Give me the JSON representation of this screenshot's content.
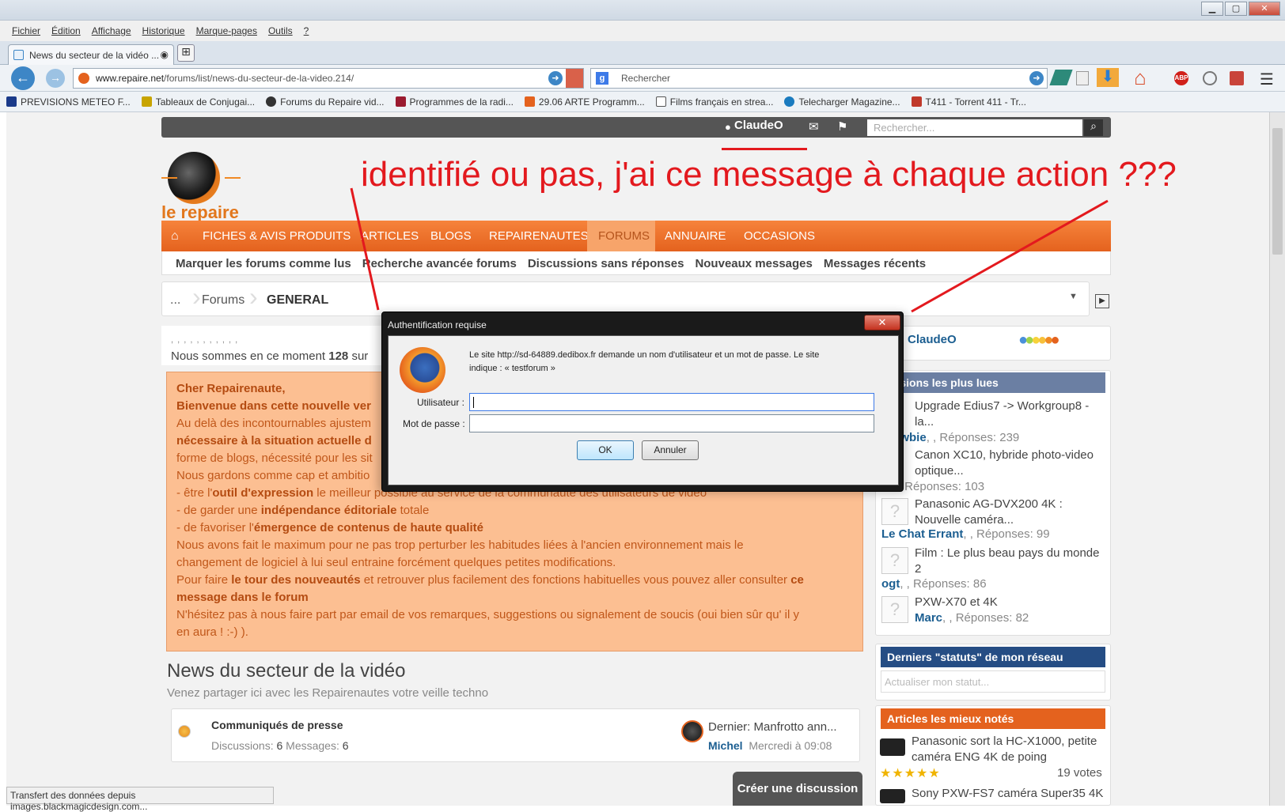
{
  "browser": {
    "menu": [
      "Fichier",
      "Édition",
      "Affichage",
      "Historique",
      "Marque-pages",
      "Outils",
      "?"
    ],
    "tab_title": "News du secteur de la vidéo ...",
    "url_domain": "www.repaire.net",
    "url_path": "/forums/list/news-du-secteur-de-la-video.214/",
    "search_placeholder": "Rechercher",
    "bookmarks": [
      {
        "label": "PREVISIONS METEO F...",
        "color": "#1a3a8a"
      },
      {
        "label": "Tableaux de Conjugai...",
        "color": "#c8a400"
      },
      {
        "label": "Forums du Repaire vid...",
        "color": "#333"
      },
      {
        "label": "Programmes de la radi...",
        "color": "#9b1b30"
      },
      {
        "label": "29.06 ARTE Programm...",
        "color": "#e4621e"
      },
      {
        "label": "Films français en strea...",
        "color": "#555"
      },
      {
        "label": "Telecharger Magazine...",
        "color": "#1a7bbf"
      },
      {
        "label": "T411 - Torrent 411 - Tr...",
        "color": "#c0392b"
      }
    ],
    "status_text": "Transfert des données depuis images.blackmagicdesign.com..."
  },
  "site": {
    "username": "ClaudeO",
    "search_placeholder": "Rechercher...",
    "logo_text": "le repaire",
    "nav": [
      "FICHES & AVIS PRODUITS",
      "ARTICLES",
      "BLOGS",
      "REPAIRENAUTES",
      "FORUMS",
      "ANNUAIRE",
      "OCCASIONS"
    ],
    "subnav": [
      "Marquer les forums comme lus",
      "Recherche avancée forums",
      "Discussions sans réponses",
      "Nouveaux messages",
      "Messages récents"
    ],
    "breadcrumb": [
      "...",
      "Forums",
      "GENERAL"
    ],
    "online_dots": ", , , , , , , , , , ,",
    "online_text_pre": "Nous sommes en ce moment ",
    "online_count": "128",
    "online_text_post": " sur",
    "welcome": {
      "l1": "Cher Repairenaute,",
      "l2": "Bienvenue dans cette nouvelle ver",
      "l3": "Au delà des incontournables ajustem",
      "l4": "nécessaire à la situation actuelle d",
      "l5": "forme de blogs, nécessité pour les sit",
      "l6": "Nous gardons comme cap et ambitio",
      "l7a": "- être l'",
      "l7b": "outil d'expression",
      "l7c": " le meilleur possible au service de la communauté des utilisateurs de vidéo",
      "l8a": "- de garder une ",
      "l8b": "indépendance éditoriale",
      "l8c": " totale",
      "l9a": "- de favoriser l'",
      "l9b": "émergence de contenus de haute qualité",
      "l10": "Nous avons fait le maximum pour ne pas trop perturber les habitudes liées à l'ancien environnement mais le",
      "l11": "changement de logiciel à lui seul entraine forcément quelques petites modifications.",
      "l12a": "Pour faire ",
      "l12b": "le tour des nouveautés",
      "l12c": " et retrouver plus facilement des fonctions habituelles vous pouvez aller consulter ",
      "l12d": "ce",
      "l13": "message dans le forum",
      "l14": "N'hésitez pas à nous faire part par email de vos remarques, suggestions ou signalement de soucis (oui bien sûr qu' il y",
      "l15": "en aura ! :-) )."
    },
    "section_title": "News du secteur de la vidéo",
    "section_desc": "Venez partager ici avec les Repairenautes votre veille techno",
    "node": {
      "title": "Communiqués de presse",
      "stats_label1": "Discussions: ",
      "discussions": "6",
      "stats_label2": " Messages: ",
      "messages": "6",
      "last_post": "Dernier: Manfrotto ann...",
      "last_user": "Michel",
      "last_date": "Mercredi à 09:08"
    },
    "create_button": "Créer une discussion",
    "sidebar": {
      "visitor_name": "ClaudeO",
      "popular_title": "ussions les plus lues",
      "popular": [
        {
          "title": "Upgrade Edius7 -> Workgroup8 -",
          "title2": "la...",
          "user": "lNewbie",
          "replies": ", , Réponses: 239"
        },
        {
          "title": "Canon XC10, hybride photo-video",
          "title2": "optique...",
          "user": "el",
          "replies": ", , Réponses: 103"
        },
        {
          "title": "Panasonic AG-DVX200 4K :",
          "title2": "Nouvelle caméra...",
          "user": "Le Chat Errant",
          "replies": ", , Réponses: 99"
        },
        {
          "title": "Film : Le plus beau pays du monde",
          "title2": "2",
          "user": "ogt",
          "replies": ", , Réponses: 86"
        },
        {
          "title": "PXW-X70 et 4K",
          "title2": "",
          "user": "Marc",
          "replies": ", , Réponses: 82"
        }
      ],
      "status_title": "Derniers \"statuts\" de mon réseau",
      "status_placeholder": "Actualiser mon statut...",
      "articles_title": "Articles les mieux notés",
      "article1": "Panasonic sort la HC-X1000, petite",
      "article1b": "caméra ENG 4K de poing",
      "stars": "★★★★★",
      "votes": "19 votes",
      "article2": "Sony PXW-FS7 caméra Super35 4K"
    }
  },
  "annotation": "identifié ou pas, j'ai ce message à chaque action ???",
  "dialog": {
    "title": "Authentification requise",
    "message1": "Le site http://sd-64889.dedibox.fr demande un nom d'utilisateur et un mot de passe. Le site",
    "message2": "indique : « testforum »",
    "user_label": "Utilisateur :",
    "pass_label": "Mot de passe :",
    "ok": "OK",
    "cancel": "Annuler"
  },
  "colors": {
    "accent": "#e4621e",
    "annotation": "#e3191e",
    "link": "#1b5e91"
  }
}
